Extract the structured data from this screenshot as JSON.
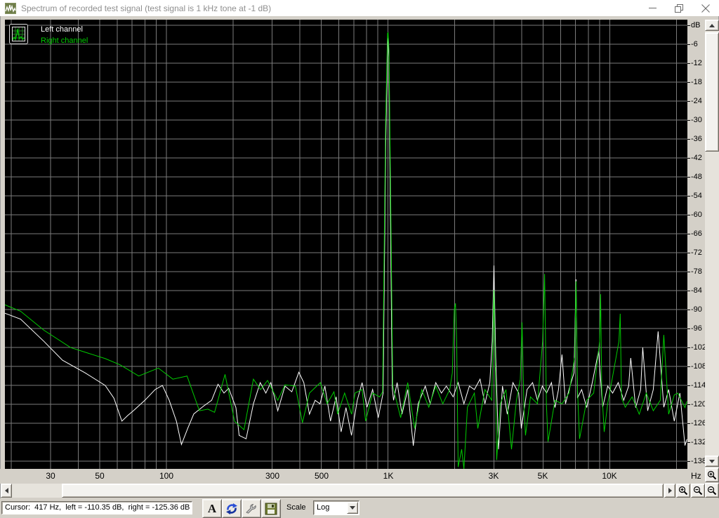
{
  "window": {
    "title": "Spectrum of recorded test signal (test signal is 1 kHz tone at -1 dB)",
    "app_icon": "waveform-icon",
    "controls": {
      "minimize": "minimize-icon",
      "restore": "restore-icon",
      "close": "close-icon"
    }
  },
  "legend": {
    "button_icon": "spectrum-thumbnail-icon",
    "items": [
      {
        "label": "Left channel",
        "color": "#ffffff"
      },
      {
        "label": "Right channel",
        "color": "#00cc00"
      }
    ]
  },
  "chart_data": {
    "type": "line",
    "title": "Spectrum of recorded test signal (test signal is 1 kHz tone at -1 dB)",
    "background": "#000000",
    "grid_color": "#7b7b7b",
    "legend_position": "top-left",
    "x_axis": {
      "label": "Hz",
      "scale": "log",
      "min": 18.7,
      "max": 22400,
      "gridlines": [
        20,
        30,
        40,
        50,
        60,
        70,
        80,
        90,
        100,
        200,
        300,
        400,
        500,
        600,
        700,
        800,
        900,
        1000,
        2000,
        3000,
        4000,
        5000,
        6000,
        7000,
        8000,
        9000,
        10000,
        20000
      ],
      "ticks": [
        {
          "f": 30,
          "label": "30"
        },
        {
          "f": 50,
          "label": "50"
        },
        {
          "f": 100,
          "label": "100"
        },
        {
          "f": 300,
          "label": "300"
        },
        {
          "f": 500,
          "label": "500"
        },
        {
          "f": 1000,
          "label": "1K"
        },
        {
          "f": 3000,
          "label": "3K"
        },
        {
          "f": 5000,
          "label": "5K"
        },
        {
          "f": 10000,
          "label": "10K"
        }
      ]
    },
    "y_axis": {
      "label": "dB",
      "min": -140.4,
      "max": 1.8,
      "grid_step": 6,
      "gridlines": [
        0,
        -6,
        -12,
        -18,
        -24,
        -30,
        -36,
        -42,
        -48,
        -54,
        -60,
        -66,
        -72,
        -78,
        -84,
        -90,
        -96,
        -102,
        -108,
        -114,
        -120,
        -126,
        -132,
        -138
      ],
      "ticks": [
        {
          "db": 0,
          "label": "dB"
        },
        {
          "db": -6,
          "label": "-6"
        },
        {
          "db": -12,
          "label": "-12"
        },
        {
          "db": -18,
          "label": "-18"
        },
        {
          "db": -24,
          "label": "-24"
        },
        {
          "db": -30,
          "label": "-30"
        },
        {
          "db": -36,
          "label": "-36"
        },
        {
          "db": -42,
          "label": "-42"
        },
        {
          "db": -48,
          "label": "-48"
        },
        {
          "db": -54,
          "label": "-54"
        },
        {
          "db": -60,
          "label": "-60"
        },
        {
          "db": -66,
          "label": "-66"
        },
        {
          "db": -72,
          "label": "-72"
        },
        {
          "db": -78,
          "label": "-78"
        },
        {
          "db": -84,
          "label": "-84"
        },
        {
          "db": -90,
          "label": "-90"
        },
        {
          "db": -96,
          "label": "-96"
        },
        {
          "db": -102,
          "label": "-102"
        },
        {
          "db": -108,
          "label": "-108"
        },
        {
          "db": -114,
          "label": "-114"
        },
        {
          "db": -120,
          "label": "-120"
        },
        {
          "db": -126,
          "label": "-126"
        },
        {
          "db": -132,
          "label": "-132"
        },
        {
          "db": -138,
          "label": "-138"
        }
      ]
    },
    "series": [
      {
        "name": "Left channel",
        "color": "#ffffff",
        "points": [
          [
            18,
            -90.7
          ],
          [
            22,
            -93
          ],
          [
            28,
            -100
          ],
          [
            34,
            -106
          ],
          [
            43,
            -110
          ],
          [
            53,
            -114
          ],
          [
            58,
            -118
          ],
          [
            63,
            -125.3
          ],
          [
            67,
            -123.5
          ],
          [
            71,
            -122
          ],
          [
            80,
            -118.7
          ],
          [
            89,
            -115.3
          ],
          [
            96,
            -114
          ],
          [
            103,
            -118.7
          ],
          [
            111,
            -125.3
          ],
          [
            117,
            -132.7
          ],
          [
            125,
            -127.5
          ],
          [
            133,
            -123
          ],
          [
            148,
            -120.4
          ],
          [
            160,
            -118.7
          ],
          [
            171,
            -113.6
          ],
          [
            182,
            -116.4
          ],
          [
            191,
            -114.9
          ],
          [
            206,
            -121
          ],
          [
            213,
            -129.8
          ],
          [
            229,
            -130.9
          ],
          [
            247,
            -119.8
          ],
          [
            265,
            -113.1
          ],
          [
            281,
            -116.4
          ],
          [
            296,
            -113.1
          ],
          [
            318,
            -122
          ],
          [
            343,
            -114.2
          ],
          [
            368,
            -116
          ],
          [
            396,
            -109.8
          ],
          [
            417,
            -113.1
          ],
          [
            442,
            -123.1
          ],
          [
            469,
            -118.7
          ],
          [
            493,
            -119.8
          ],
          [
            519,
            -114.2
          ],
          [
            550,
            -125.3
          ],
          [
            583,
            -117.6
          ],
          [
            614,
            -128.7
          ],
          [
            646,
            -121
          ],
          [
            684,
            -129.8
          ],
          [
            726,
            -118.7
          ],
          [
            764,
            -113.1
          ],
          [
            803,
            -120.9
          ],
          [
            852,
            -115.3
          ],
          [
            903,
            -124.2
          ],
          [
            950,
            -116.4
          ],
          [
            975,
            -40
          ],
          [
            995,
            -4.5
          ],
          [
            1000,
            -4.2
          ],
          [
            1008,
            -10
          ],
          [
            1025,
            -60
          ],
          [
            1045,
            -115
          ],
          [
            1059,
            -118.7
          ],
          [
            1099,
            -113.1
          ],
          [
            1156,
            -123.1
          ],
          [
            1227,
            -115.3
          ],
          [
            1300,
            -133.1
          ],
          [
            1368,
            -119.8
          ],
          [
            1472,
            -114.2
          ],
          [
            1549,
            -119.8
          ],
          [
            1641,
            -113.1
          ],
          [
            1741,
            -116.4
          ],
          [
            1832,
            -114.2
          ],
          [
            1967,
            -117.6
          ],
          [
            2071,
            -113.1
          ],
          [
            2198,
            -119.8
          ],
          [
            2328,
            -114.2
          ],
          [
            2451,
            -115.3
          ],
          [
            2600,
            -112
          ],
          [
            2734,
            -119.8
          ],
          [
            2877,
            -113.1
          ],
          [
            2950,
            -100
          ],
          [
            3005,
            -76
          ],
          [
            3060,
            -105
          ],
          [
            3150,
            -134.2
          ],
          [
            3281,
            -114.2
          ],
          [
            3451,
            -123.1
          ],
          [
            3659,
            -113.1
          ],
          [
            3882,
            -116.4
          ],
          [
            3993,
            -127.6
          ],
          [
            4234,
            -115.3
          ],
          [
            4488,
            -113.1
          ],
          [
            4721,
            -118.7
          ],
          [
            4965,
            -114.2
          ],
          [
            5189,
            -116.4
          ],
          [
            5459,
            -113.1
          ],
          [
            5661,
            -121
          ],
          [
            5872,
            -115.3
          ],
          [
            6090,
            -104.2
          ],
          [
            6318,
            -119.8
          ],
          [
            6552,
            -115.3
          ],
          [
            6900,
            -110
          ],
          [
            7047,
            -80.4
          ],
          [
            7150,
            -118
          ],
          [
            7467,
            -115.3
          ],
          [
            7870,
            -121
          ],
          [
            8338,
            -113.1
          ],
          [
            8902,
            -103.1
          ],
          [
            9290,
            -120.9
          ],
          [
            9792,
            -114.2
          ],
          [
            10300,
            -116.4
          ],
          [
            10920,
            -113.1
          ],
          [
            11560,
            -118.7
          ],
          [
            12170,
            -114.2
          ],
          [
            12440,
            -105.3
          ],
          [
            13090,
            -121
          ],
          [
            13780,
            -115.3
          ],
          [
            14090,
            -102
          ],
          [
            14830,
            -122
          ],
          [
            15710,
            -115.3
          ],
          [
            16530,
            -96.9
          ],
          [
            17530,
            -120.9
          ],
          [
            18440,
            -115.3
          ],
          [
            19540,
            -125.3
          ],
          [
            20720,
            -116.4
          ],
          [
            21830,
            -133
          ],
          [
            22290,
            -131
          ]
        ]
      },
      {
        "name": "Right channel",
        "color": "#00cc00",
        "points": [
          [
            18,
            -88
          ],
          [
            22,
            -90.5
          ],
          [
            28,
            -96.5
          ],
          [
            37,
            -102
          ],
          [
            53,
            -105.5
          ],
          [
            62,
            -107.5
          ],
          [
            75,
            -111
          ],
          [
            92,
            -108.5
          ],
          [
            107,
            -112
          ],
          [
            124,
            -111
          ],
          [
            141,
            -122
          ],
          [
            154,
            -121.5
          ],
          [
            165,
            -122.5
          ],
          [
            184,
            -110.5
          ],
          [
            203,
            -125.3
          ],
          [
            224,
            -128
          ],
          [
            247,
            -112
          ],
          [
            266,
            -115.3
          ],
          [
            286,
            -112.4
          ],
          [
            318,
            -118.7
          ],
          [
            343,
            -113.8
          ],
          [
            382,
            -114.2
          ],
          [
            411,
            -125.8
          ],
          [
            442,
            -116.4
          ],
          [
            495,
            -113.1
          ],
          [
            531,
            -119.8
          ],
          [
            570,
            -116
          ],
          [
            592,
            -123.1
          ],
          [
            637,
            -116.4
          ],
          [
            685,
            -123.1
          ],
          [
            710,
            -116.4
          ],
          [
            764,
            -115.3
          ],
          [
            792,
            -125.3
          ],
          [
            852,
            -116.4
          ],
          [
            916,
            -117.6
          ],
          [
            945,
            -116
          ],
          [
            975,
            -30
          ],
          [
            995,
            -2.5
          ],
          [
            1000,
            -2.3
          ],
          [
            1010,
            -8
          ],
          [
            1030,
            -60
          ],
          [
            1050,
            -114
          ],
          [
            1060,
            -115.3
          ],
          [
            1140,
            -124.2
          ],
          [
            1227,
            -113.1
          ],
          [
            1318,
            -127.6
          ],
          [
            1420,
            -115.3
          ],
          [
            1527,
            -120.9
          ],
          [
            1641,
            -114.2
          ],
          [
            1766,
            -119.8
          ],
          [
            1897,
            -115.3
          ],
          [
            1950,
            -110
          ],
          [
            1990,
            -90
          ],
          [
            2014,
            -88
          ],
          [
            2040,
            -100
          ],
          [
            2071,
            -139.8
          ],
          [
            2148,
            -134.2
          ],
          [
            2198,
            -140.4
          ],
          [
            2280,
            -120.9
          ],
          [
            2451,
            -116.4
          ],
          [
            2541,
            -127.6
          ],
          [
            2734,
            -115.3
          ],
          [
            2938,
            -118.7
          ],
          [
            2980,
            -95
          ],
          [
            3005,
            -83.8
          ],
          [
            3050,
            -110
          ],
          [
            3090,
            -137.6
          ],
          [
            3206,
            -119.8
          ],
          [
            3402,
            -115.3
          ],
          [
            3606,
            -134.2
          ],
          [
            3795,
            -118.7
          ],
          [
            3950,
            -112
          ],
          [
            4021,
            -94
          ],
          [
            4100,
            -120
          ],
          [
            4169,
            -129.8
          ],
          [
            4389,
            -117.6
          ],
          [
            4721,
            -119.8
          ],
          [
            4980,
            -100
          ],
          [
            5082,
            -78.7
          ],
          [
            5180,
            -120
          ],
          [
            5266,
            -131.8
          ],
          [
            5661,
            -118.7
          ],
          [
            6090,
            -119.8
          ],
          [
            6552,
            -116.4
          ],
          [
            6950,
            -105
          ],
          [
            7047,
            -81
          ],
          [
            7150,
            -115
          ],
          [
            7310,
            -130.9
          ],
          [
            7870,
            -118.7
          ],
          [
            8460,
            -116.4
          ],
          [
            9000,
            -100
          ],
          [
            9097,
            -85.1
          ],
          [
            9200,
            -115
          ],
          [
            9441,
            -128.7
          ],
          [
            9792,
            -119.8
          ],
          [
            11000,
            -100
          ],
          [
            11150,
            -91.3
          ],
          [
            11300,
            -118
          ],
          [
            11750,
            -120.9
          ],
          [
            12620,
            -117.6
          ],
          [
            13580,
            -123.1
          ],
          [
            14620,
            -116.4
          ],
          [
            15710,
            -122
          ],
          [
            16900,
            -118.7
          ],
          [
            17530,
            -98
          ],
          [
            18440,
            -123.1
          ],
          [
            19540,
            -117
          ],
          [
            20270,
            -116.4
          ],
          [
            21830,
            -121
          ],
          [
            22290,
            -119
          ]
        ]
      }
    ]
  },
  "scrollbars": {
    "vertical": {
      "up_icon": "arrow-up-icon",
      "down_icon": "arrow-down-icon"
    },
    "horizontal": {
      "left_icon": "arrow-left-icon",
      "right_icon": "arrow-right-icon"
    }
  },
  "zoom_controls": {
    "y_zoom_in_icon": "zoom-in-icon",
    "y_zoom_out_icon": "zoom-out-icon",
    "x_zoom_in_icon": "zoom-in-icon",
    "x_zoom_out_icon": "zoom-out-icon"
  },
  "statusbar": {
    "cursor_text": "Cursor:  417 Hz,  left = -110.35 dB,  right = -125.36 dB"
  },
  "toolbar": {
    "font_button_label": "A",
    "refresh_icon": "refresh-icon",
    "settings_icon": "wrench-icon",
    "save_icon": "save-icon",
    "scale_label": "Scale",
    "scale_value": "Log",
    "dropdown_icon": "chevron-down-icon"
  }
}
